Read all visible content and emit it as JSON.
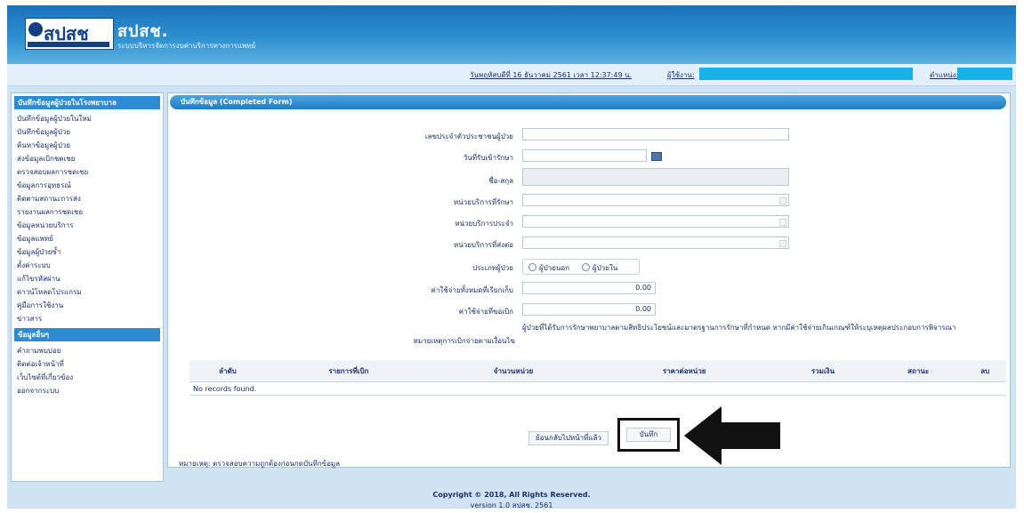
{
  "header": {
    "logo_text": "สปสช",
    "brand": "สปสช.",
    "subtitle": "ระบบบริหารจัดการงบค่าบริการทางการแพทย์"
  },
  "infobar": {
    "datetime": "วันพฤหัสบดีที่ 16 ธันวาคม 2561 เวลา 12:37:49 น.",
    "user_label": "ผู้ใช้งาน:",
    "position_label": "ตำแหน่ง:"
  },
  "sidebar": {
    "section1": "บันทึกข้อมูลผู้ป่วยในโรงพยาบาล",
    "items1": [
      "บันทึกข้อมูลผู้ป่วยในใหม่",
      "บันทึกข้อมูลผู้ป่วย",
      "ค้นหาข้อมูลผู้ป่วย",
      "ส่งข้อมูลเบิกชดเชย",
      "ตรวจสอบผลการชดเชย",
      "ข้อมูลการอุทธรณ์",
      "ติดตามสถานะการส่ง",
      "รายงานผลการชดเชย",
      "ข้อมูลหน่วยบริการ",
      "ข้อมูลแพทย์",
      "ข้อมูลผู้ป่วยซ้ำ",
      "ตั้งค่าระบบ",
      "แก้ไขรหัสผ่าน",
      "ดาวน์โหลดโปรแกรม",
      "คู่มือการใช้งาน",
      "ข่าวสาร"
    ],
    "section2": "ข้อมูลอื่นๆ",
    "items2": [
      "คำถามพบบ่อย",
      "ติดต่อเจ้าหน้าที่",
      "เว็บไซต์ที่เกี่ยวข้อง",
      "ออกจากระบบ"
    ]
  },
  "main": {
    "title": "บันทึกข้อมูล (Completed Form)",
    "fields": [
      {
        "label": "เลขประจำตัวประชาชนผู้ป่วย",
        "value": ""
      },
      {
        "label": "วันที่รับเข้ารักษา",
        "value": ""
      },
      {
        "label": "ชื่อ-สกุล",
        "value": ""
      },
      {
        "label": "หน่วยบริการที่รักษา",
        "value": ""
      },
      {
        "label": "หน่วยบริการประจำ",
        "value": ""
      },
      {
        "label": "หน่วยบริการที่ส่งต่อ",
        "value": ""
      }
    ],
    "type_label": "ประเภทผู้ป่วย",
    "radio1": "ผู้ป่วยนอก",
    "radio2": "ผู้ป่วยใน",
    "amount1_label": "ค่าใช้จ่ายทั้งหมดที่เรียกเก็บ",
    "amount1": "0.00",
    "amount2_label": "ค่าใช้จ่ายที่ขอเบิก",
    "amount2": "0.00",
    "note_label": "หมายเหตุการเบิกจ่ายตามเงื่อนไข",
    "note_text": "ผู้ป่วยที่ได้รับการรักษาพยาบาลตามสิทธิประโยชน์และมาตรฐานการรักษาที่กำหนด หากมีค่าใช้จ่ายเกินเกณฑ์ให้ระบุเหตุผลประกอบการพิจารณา",
    "table_headers": [
      "ลำดับ",
      "รายการที่เบิก",
      "จำนวนหน่วย",
      "ราคาต่อหน่วย",
      "รวมเงิน",
      "สถานะ",
      "ลบ"
    ],
    "table_empty": "No records found.",
    "btn_back": "ย้อนกลับไปหน้าที่แล้ว",
    "btn_save": "บันทึก",
    "footnote": "หมายเหตุ: ตรวจสอบความถูกต้องก่อนกดบันทึกข้อมูล"
  },
  "footer": {
    "copyright": "Copyright © 2018, All Rights Reserved.",
    "version": "version 1.0 สปสช. 2561"
  }
}
